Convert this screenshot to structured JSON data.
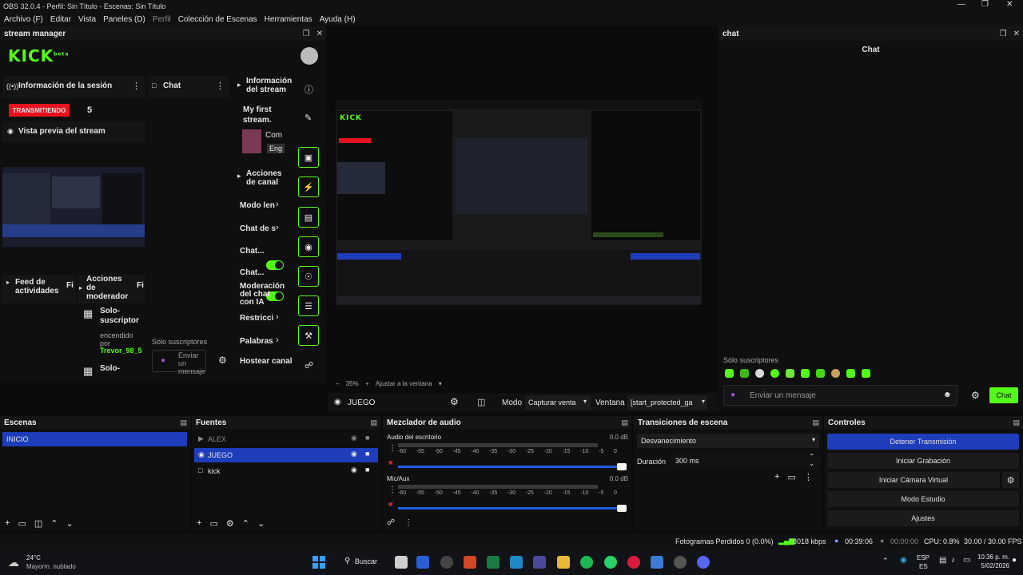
{
  "window": {
    "title": "OBS 32.0.4 - Perfil: Sin Título - Escenas: Sin Título"
  },
  "menu": [
    "Archivo (F)",
    "Editar",
    "Vista",
    "Paneles (D)",
    "Perfil",
    "Colección de Escenas",
    "Herramientas",
    "Ayuda (H)"
  ],
  "stream_manager": {
    "title": "stream manager",
    "brand": "KICK",
    "brand_sup": "beta",
    "session": {
      "heading": "Información de la sesión",
      "live_badge": "TRANSMITIENDO",
      "viewers": "5",
      "preview_label": "Vista previa del stream"
    },
    "chat": {
      "heading": "Chat",
      "subs_only": "Sólo suscriptores",
      "send_placeholder": "Enviar un mensaje"
    },
    "stream_info": {
      "heading": "Información del stream",
      "stream_title": "My first stream.",
      "category_line1": "Com",
      "category_line2": "Eng"
    },
    "channel_actions": {
      "heading": "Acciones de canal",
      "items": [
        "Modo len",
        "Chat de s",
        "Chat...",
        "Chat...",
        "Moderación del chat con IA",
        "Restricci",
        "Palabras",
        "Hostear canal"
      ]
    },
    "activity": {
      "heading": "Feed de actividades",
      "filter": "Fi"
    },
    "mod_actions": {
      "heading": "Acciones de moderador",
      "filter": "Fi",
      "item1": "Solo-suscriptor",
      "status": "encendido por",
      "user": "Trevor_98_5",
      "item2": "Solo-"
    }
  },
  "preview": {
    "zoom": "35%",
    "fit": "Ajustar a la ventana",
    "source_name": "JUEGO",
    "mode_label": "Modo",
    "mode_value": "Capturar venta",
    "window_label": "Ventana",
    "window_value": "[start_protected_ga"
  },
  "chat_dock": {
    "title": "chat",
    "heading": "Chat",
    "subs_only": "Sólo suscriptores",
    "input_placeholder": "Enviar un mensaje",
    "send": "Chat"
  },
  "scenes": {
    "title": "Escenas",
    "items": [
      "INICIO"
    ]
  },
  "sources": {
    "title": "Fuentes",
    "items": [
      "ALEX",
      "JUEGO",
      "kick"
    ]
  },
  "mixer": {
    "title": "Mezclador de audio",
    "channels": [
      {
        "name": "Audio del escritorio",
        "db": "0.0 dB"
      },
      {
        "name": "Mic/Aux",
        "db": "0.0 dB"
      }
    ],
    "ticks": [
      "-60",
      "-55",
      "-50",
      "-45",
      "-40",
      "-35",
      "-30",
      "-25",
      "-20",
      "-15",
      "-10",
      "-5",
      "0"
    ]
  },
  "transitions": {
    "title": "Transiciones de escena",
    "selected": "Desvanecimiento",
    "duration_label": "Duración",
    "duration_value": "300 ms"
  },
  "controls": {
    "title": "Controles",
    "buttons": [
      "Detener Transmisión",
      "Iniciar Grabación",
      "Iniciar Cámara Virtual",
      "Modo Estudio",
      "Ajustes"
    ]
  },
  "statusbar": {
    "dropped": "Fotogramas Perdidos 0 (0.0%)",
    "bitrate": "8018 kbps",
    "stream_time": "00:39:06",
    "rec_time": "00:00:00",
    "cpu": "CPU: 0.8%",
    "fps": "30.00 / 30.00 FPS"
  },
  "taskbar": {
    "weather_temp": "24°C",
    "weather_desc": "Mayorm. nublado",
    "search": "Buscar",
    "lang1": "ESP",
    "lang2": "ES",
    "time": "10:36 p. m.",
    "date": "5/02/2026"
  },
  "colors": {
    "kick_green": "#53fc18",
    "live_red": "#e8121f",
    "obs_blue": "#1e3dbb"
  }
}
